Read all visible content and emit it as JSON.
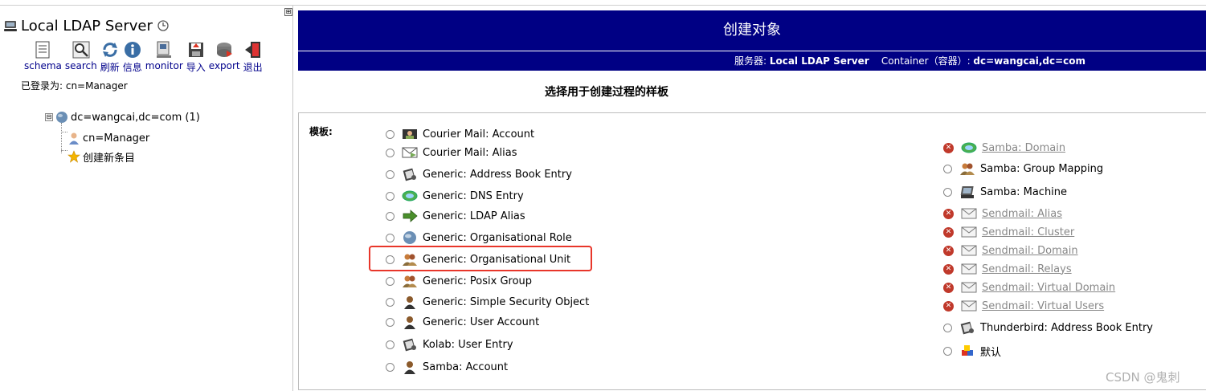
{
  "left": {
    "collapse": "⊞",
    "server_name": "Local LDAP Server",
    "toolbar": [
      {
        "label": "schema",
        "icon": "schema-icon"
      },
      {
        "label": "search",
        "icon": "search-icon"
      },
      {
        "label": "刷新",
        "icon": "refresh-icon"
      },
      {
        "label": "信息",
        "icon": "info-icon"
      },
      {
        "label": "monitor",
        "icon": "monitor-icon"
      },
      {
        "label": "导入",
        "icon": "import-icon"
      },
      {
        "label": "export",
        "icon": "export-icon"
      },
      {
        "label": "退出",
        "icon": "logout-icon"
      }
    ],
    "logged_in": "已登录为: cn=Manager",
    "tree": {
      "toggle": "⊟",
      "root": "dc=wangcai,dc=com (1)",
      "child1": "cn=Manager",
      "child2": "创建新条目"
    }
  },
  "header": {
    "title": "创建对象",
    "server_label": "服务器: ",
    "server_value": "Local LDAP Server",
    "container_label": "Container（容器）: ",
    "container_value": "dc=wangcai,dc=com"
  },
  "choose_title": "选择用于创建过程的样板",
  "templates_label": "模板:",
  "templates_left": [
    {
      "label": "Courier Mail: Account",
      "icon": "mail-user-icon"
    },
    {
      "label": "Courier Mail: Alias",
      "icon": "mail-alias-icon"
    },
    {
      "label": "Generic: Address Book Entry",
      "icon": "address-book-icon"
    },
    {
      "label": "Generic: DNS Entry",
      "icon": "dns-icon"
    },
    {
      "label": "Generic: LDAP Alias",
      "icon": "arrow-right-icon"
    },
    {
      "label": "Generic: Organisational Role",
      "icon": "globe-icon"
    },
    {
      "label": "Generic: Organisational Unit",
      "icon": "group-icon"
    },
    {
      "label": "Generic: Posix Group",
      "icon": "group-icon"
    },
    {
      "label": "Generic: Simple Security Object",
      "icon": "user-icon"
    },
    {
      "label": "Generic: User Account",
      "icon": "user-icon"
    },
    {
      "label": "Kolab: User Entry",
      "icon": "address-book-icon"
    },
    {
      "label": "Samba: Account",
      "icon": "user-icon"
    }
  ],
  "templates_right": [
    {
      "label": "Samba: Domain",
      "icon": "dns-icon",
      "disabled": true
    },
    {
      "label": "Samba: Group Mapping",
      "icon": "group-icon",
      "disabled": false
    },
    {
      "label": "Samba: Machine",
      "icon": "computer-icon",
      "disabled": false
    },
    {
      "label": "Sendmail: Alias",
      "icon": "envelope-icon",
      "disabled": true
    },
    {
      "label": "Sendmail: Cluster",
      "icon": "envelope-icon",
      "disabled": true
    },
    {
      "label": "Sendmail: Domain",
      "icon": "envelope-icon",
      "disabled": true
    },
    {
      "label": "Sendmail: Relays",
      "icon": "envelope-icon",
      "disabled": true
    },
    {
      "label": "Sendmail: Virtual Domain",
      "icon": "envelope-icon",
      "disabled": true
    },
    {
      "label": "Sendmail: Virtual Users",
      "icon": "envelope-icon",
      "disabled": true
    },
    {
      "label": "Thunderbird: Address Book Entry",
      "icon": "address-book-icon",
      "disabled": false
    },
    {
      "label": "默认",
      "icon": "blocks-icon",
      "disabled": false
    }
  ],
  "disabled_mark": "✕",
  "watermark": "CSDN @鬼刺",
  "colors": {
    "header_bg": "#000084",
    "highlight": "#e8362a",
    "disabled": "#c0392b",
    "link": "#00008b"
  }
}
